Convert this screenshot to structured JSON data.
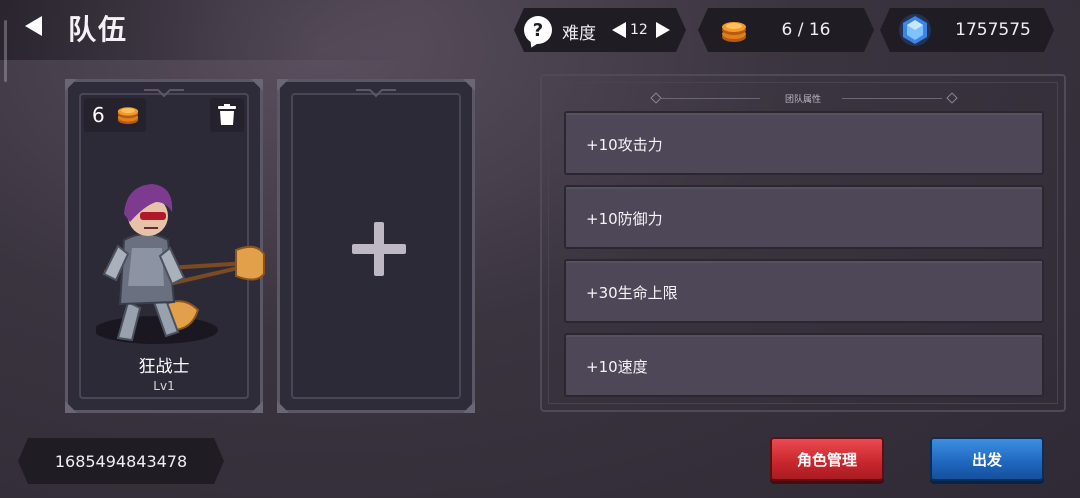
{
  "header": {
    "title": "队伍",
    "back_icon": "back-arrow-icon"
  },
  "resources": {
    "difficulty_label": "难度",
    "difficulty_value": "12",
    "gold": "6 / 16",
    "gems": "1757575"
  },
  "team": {
    "slots": [
      {
        "type": "hero",
        "cost": "6",
        "name": "狂战士",
        "level": "Lv1"
      },
      {
        "type": "empty"
      }
    ]
  },
  "attributes": {
    "header": "团队属性",
    "items": [
      "+10攻击力",
      "+10防御力",
      "+30生命上限",
      "+10速度"
    ]
  },
  "footer": {
    "player_id": "1685494843478",
    "manage_button": "角色管理",
    "depart_button": "出发"
  },
  "colors": {
    "background": "#3a343f",
    "panel_dark": "#1f1c24",
    "red_button": "#c7262d",
    "blue_button": "#1e66bd"
  }
}
